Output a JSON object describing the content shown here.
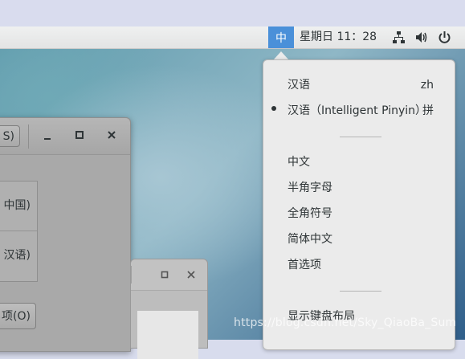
{
  "panel": {
    "input_indicator": "中",
    "clock": "星期日 11：28",
    "icons": [
      "network-icon",
      "volume-icon",
      "power-icon"
    ]
  },
  "background_window": {
    "title_button": "S)",
    "controls": [
      "minimize-icon",
      "maximize-icon",
      "close-icon"
    ],
    "list_items": [
      "中国)",
      "汉语)"
    ],
    "options_button": "项(O)"
  },
  "small_window": {
    "controls": [
      "maximize-icon",
      "close-icon"
    ]
  },
  "input_menu": {
    "items": [
      {
        "label": "汉语",
        "shortcut": "zh"
      },
      {
        "label": "汉语（Intelligent Pinyin）",
        "shortcut": "拼",
        "selected": true
      }
    ],
    "options": [
      "中文",
      "半角字母",
      "全角符号",
      "简体中文",
      "首选项"
    ],
    "footer": "显示键盘布局"
  },
  "watermark": "https://blog.csdn.net/Sky_QiaoBa_Sum",
  "colors": {
    "accent": "#4a90d9",
    "menu_bg": "#ebebeb",
    "panel_bg": "#e8e8e8"
  }
}
